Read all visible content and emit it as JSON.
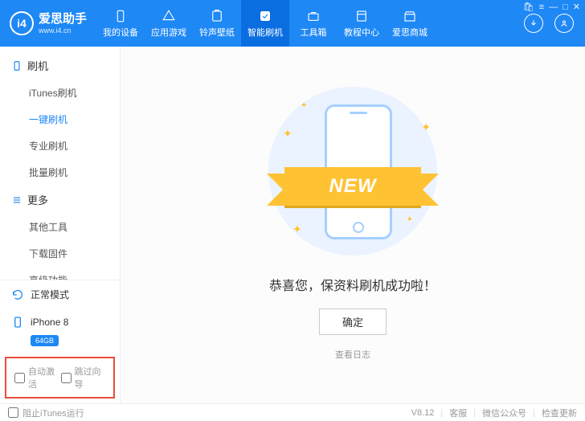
{
  "brand": {
    "name": "爱思助手",
    "url": "www.i4.cn",
    "logo": "i4"
  },
  "nav": [
    {
      "label": "我的设备",
      "icon": "phone"
    },
    {
      "label": "应用游戏",
      "icon": "apps"
    },
    {
      "label": "铃声壁纸",
      "icon": "music"
    },
    {
      "label": "智能刷机",
      "icon": "flash",
      "active": true
    },
    {
      "label": "工具箱",
      "icon": "toolbox"
    },
    {
      "label": "教程中心",
      "icon": "book"
    },
    {
      "label": "爱思商城",
      "icon": "shop"
    }
  ],
  "win": {
    "cart": "🛍",
    "menu": "≡",
    "min": "—",
    "max": "□",
    "close": "✕"
  },
  "sidebar": {
    "groups": [
      {
        "title": "刷机",
        "items": [
          {
            "label": "iTunes刷机"
          },
          {
            "label": "一键刷机",
            "active": true
          },
          {
            "label": "专业刷机"
          },
          {
            "label": "批量刷机"
          }
        ]
      },
      {
        "title": "更多",
        "items": [
          {
            "label": "其他工具"
          },
          {
            "label": "下载固件"
          },
          {
            "label": "高级功能"
          }
        ]
      }
    ],
    "mode": "正常模式",
    "device": {
      "name": "iPhone 8",
      "storage": "64GB"
    },
    "checks": [
      {
        "label": "自动激活"
      },
      {
        "label": "跳过向导"
      }
    ]
  },
  "main": {
    "ribbon": "NEW",
    "success": "恭喜您，保资料刷机成功啦！",
    "ok": "确定",
    "log": "查看日志"
  },
  "footer": {
    "itunes": "阻止iTunes运行",
    "version": "V8.12",
    "links": [
      "客服",
      "微信公众号",
      "检查更新"
    ]
  }
}
